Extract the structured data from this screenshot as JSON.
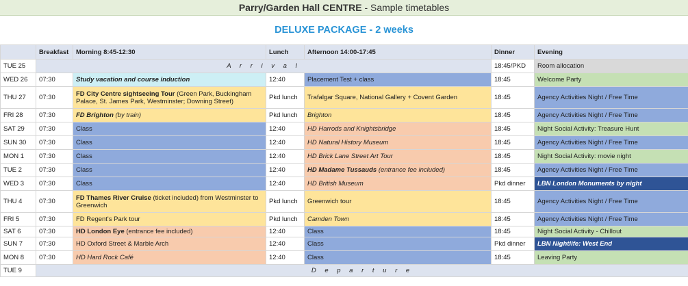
{
  "header": {
    "title_bold": "Parry/Garden Hall CENTRE",
    "title_rest": " - Sample timetables"
  },
  "package": "DELUXE PACKAGE - 2 weeks",
  "columns": [
    "",
    "Breakfast",
    "Morning 8:45-12:30",
    "Lunch",
    "Afternoon 14:00-17:45",
    "Dinner",
    "Evening"
  ],
  "rows": [
    {
      "day": "TUE 25",
      "span": "A r r i v a l",
      "dinner": "18:45/PKD",
      "evening": "Room allocation",
      "evening_style": "grey"
    },
    {
      "day": "WED 26",
      "breakfast": "07:30",
      "morning_bold": "Study vacation and course induction",
      "morning_style": "cyan",
      "morning_italic": true,
      "lunch": "12:40",
      "afternoon": "Placement Test + class",
      "afternoon_style": "blue",
      "dinner": "18:45",
      "evening": "Welcome Party",
      "evening_style": "green"
    },
    {
      "day": "THU 27",
      "breakfast": "07:30",
      "morning_bold": "FD City Centre sightseeing Tour",
      "morning": " (Green Park, Buckingham Palace, St. James Park, Westminster; Downing Street)",
      "morning_style": "yellow",
      "lunch": "Pkd lunch",
      "afternoon": "Trafalgar Square, National Gallery + Covent Garden",
      "afternoon_style": "yellow",
      "dinner": "18:45",
      "evening": "Agency Activities Night / Free Time",
      "evening_style": "blue"
    },
    {
      "day": "FRI 28",
      "breakfast": "07:30",
      "morning_bold": "FD Brighton",
      "morning": "  (by train)",
      "morning_style": "yellow",
      "morning_italic": true,
      "lunch": "Pkd lunch",
      "afternoon": "Brighton",
      "afternoon_style": "yellow",
      "afternoon_italic": true,
      "dinner": "18:45",
      "evening": "Agency Activities Night / Free Time",
      "evening_style": "blue"
    },
    {
      "day": "SAT 29",
      "breakfast": "07:30",
      "morning": "Class",
      "morning_style": "blue",
      "lunch": "12:40",
      "afternoon": "HD Harrods and Knightsbridge",
      "afternoon_style": "peach",
      "afternoon_italic": true,
      "dinner": "18:45",
      "evening": "Night Social Activity: Treasure Hunt",
      "evening_style": "green"
    },
    {
      "day": "SUN 30",
      "breakfast": "07:30",
      "morning": "Class",
      "morning_style": "blue",
      "lunch": "12:40",
      "afternoon": "HD Natural History Museum",
      "afternoon_style": "peach",
      "afternoon_italic": true,
      "dinner": "18:45",
      "evening": "Agency Activities Night / Free Time",
      "evening_style": "blue"
    },
    {
      "day": "MON 1",
      "breakfast": "07:30",
      "morning": "Class",
      "morning_style": "blue",
      "lunch": "12:40",
      "afternoon": "HD Brick Lane Street Art Tour",
      "afternoon_style": "peach",
      "afternoon_italic": true,
      "dinner": "18:45",
      "evening": "Night Social Activity: movie night",
      "evening_style": "green"
    },
    {
      "day": "TUE 2",
      "breakfast": "07:30",
      "morning": "Class",
      "morning_style": "blue",
      "lunch": "12:40",
      "afternoon_bold": "HD  Madame Tussauds",
      "afternoon": "  (entrance fee included)",
      "afternoon_style": "peach",
      "afternoon_italic": true,
      "dinner": "18:45",
      "evening": "Agency Activities Night / Free Time",
      "evening_style": "blue"
    },
    {
      "day": "WED 3",
      "breakfast": "07:30",
      "morning": "Class",
      "morning_style": "blue",
      "lunch": "12:40",
      "afternoon": "HD British Museum",
      "afternoon_style": "peach",
      "afternoon_italic": true,
      "dinner": "Pkd dinner",
      "evening": "LBN London Monuments by night",
      "evening_style": "navy"
    },
    {
      "day": "THU 4",
      "breakfast": "07:30",
      "morning_bold": "FD Thames River Cruise",
      "morning": " (ticket included) from Westminster to Greenwich",
      "morning_style": "yellow",
      "lunch": "Pkd lunch",
      "afternoon": "Greenwich tour",
      "afternoon_style": "yellow",
      "dinner": "18:45",
      "evening": "Agency Activities Night / Free Time",
      "evening_style": "blue"
    },
    {
      "day": "FRI 5",
      "breakfast": "07:30",
      "morning": "FD Regent's Park tour",
      "morning_style": "yellow",
      "lunch": "Pkd lunch",
      "afternoon": "Camden Town",
      "afternoon_style": "yellow",
      "afternoon_italic": true,
      "dinner": "18:45",
      "evening": "Agency Activities Night / Free Time",
      "evening_style": "blue"
    },
    {
      "day": "SAT 6",
      "breakfast": "07:30",
      "morning_bold": "HD London Eye",
      "morning": " (entrance fee included)",
      "morning_style": "peach",
      "lunch": "12:40",
      "afternoon": "Class",
      "afternoon_style": "blue",
      "dinner": "18:45",
      "evening": "Night Social Activity - Chillout",
      "evening_style": "green"
    },
    {
      "day": "SUN 7",
      "breakfast": "07:30",
      "morning": "HD Oxford Street & Marble Arch",
      "morning_style": "peach",
      "lunch": "12:40",
      "afternoon": "Class",
      "afternoon_style": "blue",
      "dinner": "Pkd dinner",
      "evening": "LBN Nightlife: West End",
      "evening_style": "navy"
    },
    {
      "day": "MON 8",
      "breakfast": "07:30",
      "morning": "HD Hard Rock Café",
      "morning_style": "peach",
      "morning_italic": true,
      "lunch": "12:40",
      "afternoon": "Class",
      "afternoon_style": "blue",
      "dinner": "18:45",
      "evening": "Leaving Party",
      "evening_style": "green"
    },
    {
      "day": "TUE 9",
      "span": "D e p a r t u r e"
    }
  ]
}
